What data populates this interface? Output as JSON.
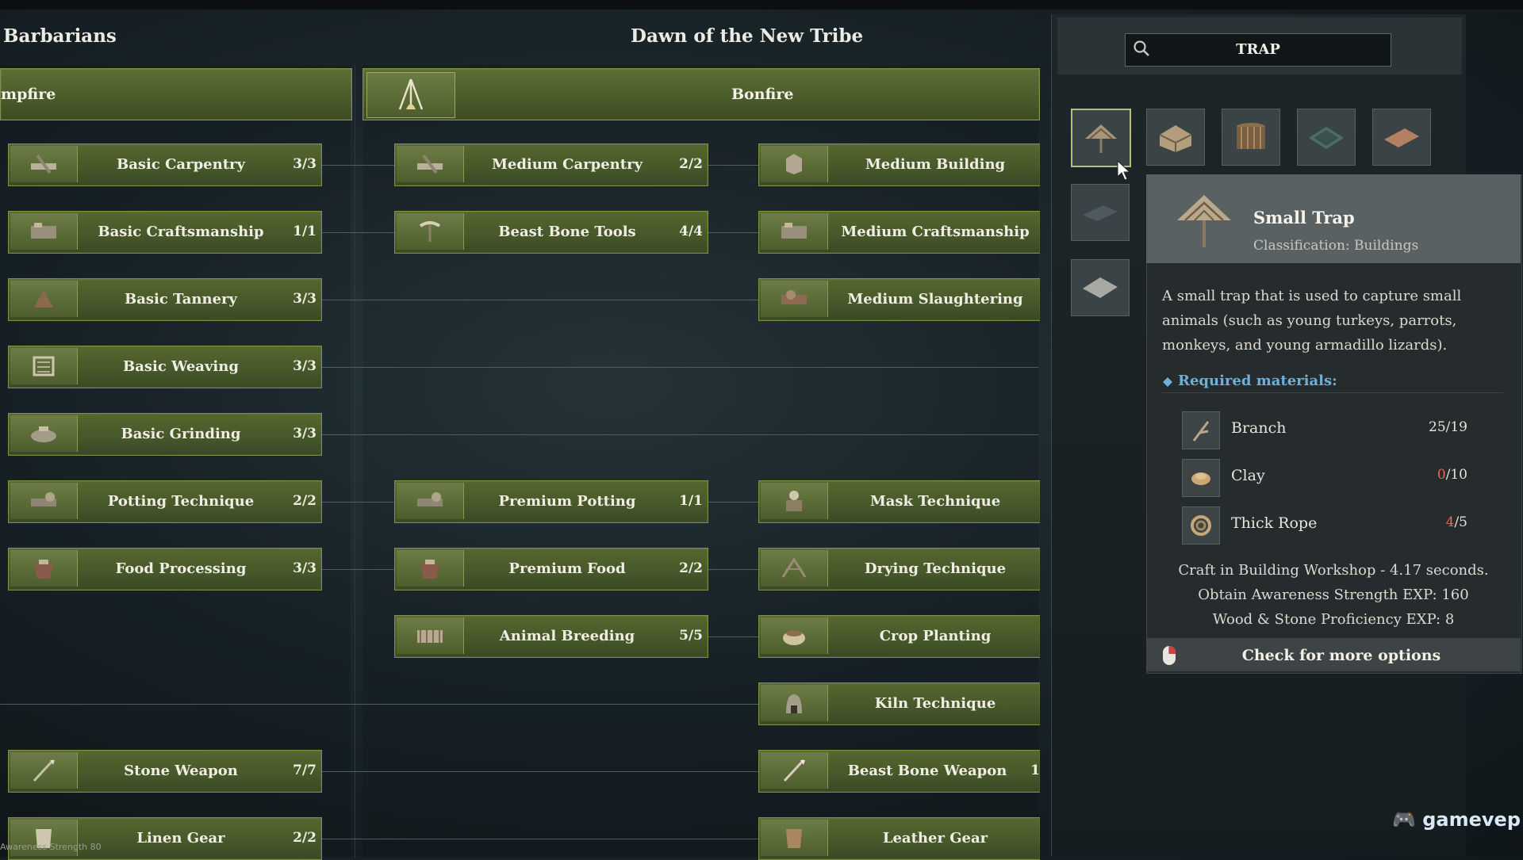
{
  "left_title": "Barbarians",
  "center_title": "Dawn of the New Tribe",
  "column_headers": {
    "left": "mpfire",
    "center": "Bonfire"
  },
  "col1": [
    {
      "label": "Basic Carpentry",
      "count": "3/3"
    },
    {
      "label": "Basic Craftsmanship",
      "count": "1/1"
    },
    {
      "label": "Basic Tannery",
      "count": "3/3"
    },
    {
      "label": "Basic Weaving",
      "count": "3/3"
    },
    {
      "label": "Basic Grinding",
      "count": "3/3"
    },
    {
      "label": "Potting Technique",
      "count": "2/2"
    },
    {
      "label": "Food Processing",
      "count": "3/3"
    },
    {
      "label": "Stone Weapon",
      "count": "7/7"
    },
    {
      "label": "Linen Gear",
      "count": "2/2"
    }
  ],
  "col2": [
    {
      "label": "Medium Carpentry",
      "count": "2/2"
    },
    {
      "label": "Beast Bone Tools",
      "count": "4/4"
    },
    {
      "label": "Premium Potting",
      "count": "1/1"
    },
    {
      "label": "Premium Food",
      "count": "2/2"
    },
    {
      "label": "Animal Breeding",
      "count": "5/5"
    }
  ],
  "col3": [
    {
      "label": "Medium Building",
      "count": ""
    },
    {
      "label": "Medium Craftsmanship",
      "count": ""
    },
    {
      "label": "Medium Slaughtering",
      "count": ""
    },
    {
      "label": "Mask Technique",
      "count": ""
    },
    {
      "label": "Drying Technique",
      "count": ""
    },
    {
      "label": "Crop Planting",
      "count": ""
    },
    {
      "label": "Kiln Technique",
      "count": ""
    },
    {
      "label": "Beast Bone Weapon",
      "count": "1"
    },
    {
      "label": "Leather Gear",
      "count": ""
    }
  ],
  "search": {
    "value": "TRAP"
  },
  "tooltip": {
    "title": "Small Trap",
    "classification": "Classification: Buildings",
    "description": "A small trap that is used to capture small animals (such as young turkeys, parrots, monkeys, and young armadillo lizards).",
    "required_heading": "Required materials:",
    "materials": [
      {
        "name": "Branch",
        "have": "25",
        "need": "/19",
        "lacking": false
      },
      {
        "name": "Clay",
        "have": "0",
        "need": "/10",
        "lacking": true
      },
      {
        "name": "Thick Rope",
        "have": "4",
        "need": "/5",
        "lacking": true
      }
    ],
    "craft_lines": [
      "Craft in Building Workshop - 4.17 seconds.",
      "Obtain Awareness Strength EXP: 160",
      "Wood & Stone Proficiency EXP: 8"
    ],
    "check_label": "Check for more options"
  },
  "footer_text": "Awareness Strength 80",
  "watermark": "gamevep",
  "colors": {
    "node_green": "#4f6029",
    "accent_blue": "#6fb0d9",
    "lacking_red": "#e56a5a"
  }
}
